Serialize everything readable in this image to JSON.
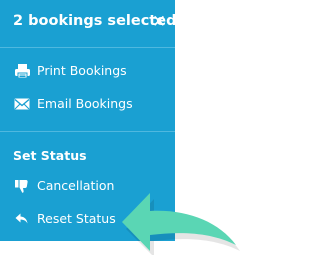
{
  "header": {
    "title": "2 bookings selected",
    "close_glyph": "✕"
  },
  "actions": [
    {
      "label": "Print Bookings",
      "icon": "printer-icon"
    },
    {
      "label": "Email Bookings",
      "icon": "envelope-icon"
    }
  ],
  "status_section": {
    "title": "Set Status",
    "items": [
      {
        "label": "Cancellation",
        "icon": "thumbs-down-icon"
      },
      {
        "label": "Reset Status",
        "icon": "reply-icon"
      }
    ]
  },
  "colors": {
    "panel": "#1aa0d2",
    "arrow": "#5ad6b4",
    "text": "#ffffff"
  }
}
